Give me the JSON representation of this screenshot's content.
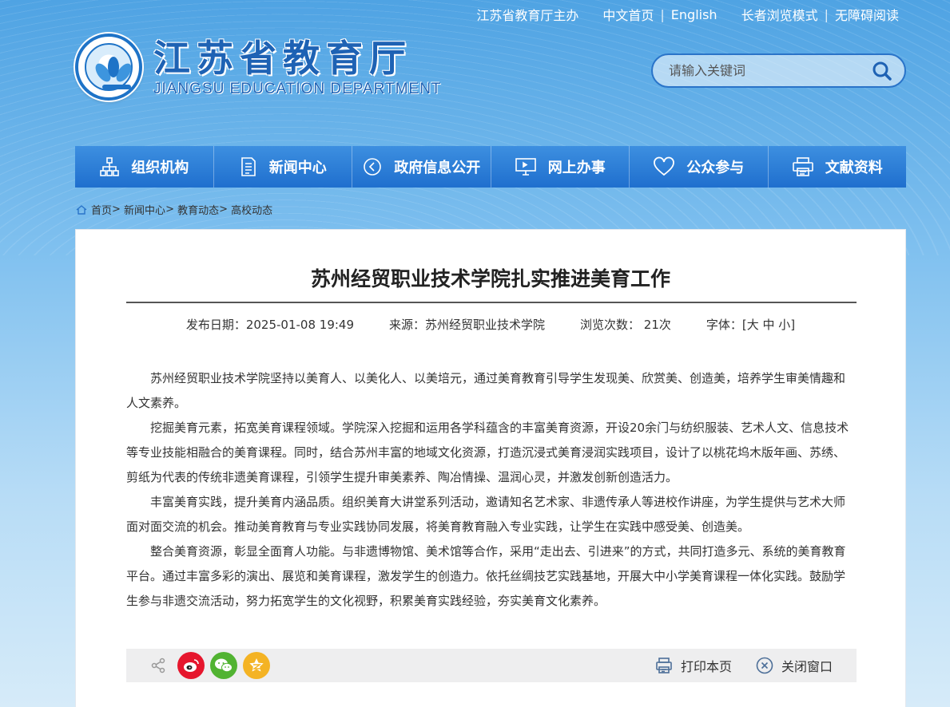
{
  "top_links": {
    "sponsor": "江苏省教育厅主办",
    "home_cn": "中文首页",
    "english": "English",
    "elder_mode": "长者浏览模式",
    "accessible": "无障碍阅读"
  },
  "logo": {
    "cn": "江苏省教育厅",
    "en": "JIANGSU EDUCATION DEPARTMENT"
  },
  "search": {
    "placeholder": "请输入关键词"
  },
  "nav": {
    "items": [
      {
        "label": "组织机构",
        "icon": "org-chart-icon"
      },
      {
        "label": "新闻中心",
        "icon": "document-icon"
      },
      {
        "label": "政府信息公开",
        "icon": "broadcast-icon"
      },
      {
        "label": "网上办事",
        "icon": "monitor-icon"
      },
      {
        "label": "公众参与",
        "icon": "heart-icon"
      },
      {
        "label": "文献资料",
        "icon": "printer-icon"
      }
    ]
  },
  "breadcrumb": {
    "home": "首页",
    "news": "新闻中心",
    "edu_news": "教育动态",
    "current": "高校动态"
  },
  "article": {
    "title": "苏州经贸职业技术学院扎实推进美育工作",
    "publish_date": "发布日期：2025-01-08 19:49",
    "source": "来源：苏州经贸职业技术学院",
    "views": "浏览次数： 21次",
    "font_size": "字体：[大 中 小]",
    "paragraphs": [
      "苏州经贸职业技术学院坚持以美育人、以美化人、以美培元，通过美育教育引导学生发现美、欣赏美、创造美，培养学生审美情趣和人文素养。",
      "挖掘美育元素，拓宽美育课程领域。学院深入挖掘和运用各学科蕴含的丰富美育资源，开设20余门与纺织服装、艺术人文、信息技术等专业技能相融合的美育课程。同时，结合苏州丰富的地域文化资源，打造沉浸式美育浸润实践项目，设计了以桃花坞木版年画、苏绣、剪纸为代表的传统非遗美育课程，引领学生提升审美素养、陶冶情操、温润心灵，并激发创新创造活力。",
      "丰富美育实践，提升美育内涵品质。组织美育大讲堂系列活动，邀请知名艺术家、非遗传承人等进校作讲座，为学生提供与艺术大师面对面交流的机会。推动美育教育与专业实践协同发展，将美育教育融入专业实践，让学生在实践中感受美、创造美。",
      "整合美育资源，彰显全面育人功能。与非遗博物馆、美术馆等合作，采用“走出去、引进来”的方式，共同打造多元、系统的美育教育平台。通过丰富多彩的演出、展览和美育课程，激发学生的创造力。依托丝绸技艺实践基地，开展大中小学美育课程一体化实践。鼓励学生参与非遗交流活动，努力拓宽学生的文化视野，积累美育实践经验，夯实美育文化素养。"
    ]
  },
  "share": {
    "print": "打印本页",
    "close": "关闭窗口"
  },
  "colors": {
    "brand_blue": "#1f6fce",
    "weibo": "#e6162d",
    "wechat": "#51b332",
    "qzone": "#f4b324"
  }
}
